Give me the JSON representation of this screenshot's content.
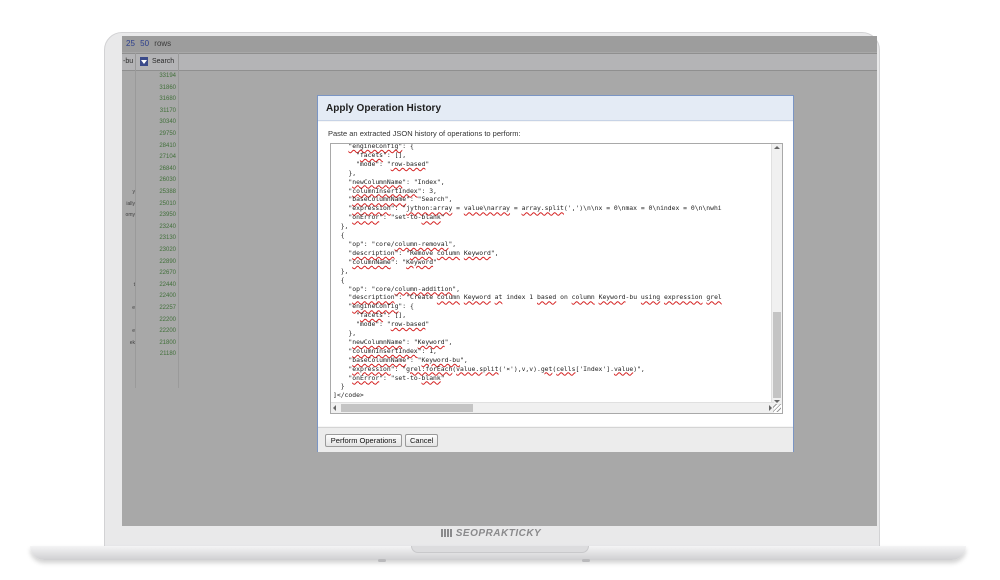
{
  "brand": {
    "name": "SEOPRAKTICKY"
  },
  "background": {
    "rows_control": {
      "option_25": "25",
      "option_50": "50",
      "rows_label": "rows"
    },
    "columns": {
      "left_partial": "-bu",
      "search": "Search"
    },
    "rows": [
      {
        "left": "",
        "value": "33194"
      },
      {
        "left": "",
        "value": "31860"
      },
      {
        "left": "",
        "value": "31680"
      },
      {
        "left": "",
        "value": "31170"
      },
      {
        "left": "",
        "value": "30340"
      },
      {
        "left": "",
        "value": "29750"
      },
      {
        "left": "",
        "value": "28410"
      },
      {
        "left": "",
        "value": "27104"
      },
      {
        "left": "",
        "value": "26840"
      },
      {
        "left": "",
        "value": "26030"
      },
      {
        "left": "y",
        "value": "25388"
      },
      {
        "left": "ially",
        "value": "25010"
      },
      {
        "left": "omy",
        "value": "23950"
      },
      {
        "left": "",
        "value": "23240"
      },
      {
        "left": "",
        "value": "23130"
      },
      {
        "left": "",
        "value": "23020"
      },
      {
        "left": "",
        "value": "22890"
      },
      {
        "left": "",
        "value": "22670"
      },
      {
        "left": "t",
        "value": "22440"
      },
      {
        "left": "",
        "value": "22400"
      },
      {
        "left": "e",
        "value": "22257"
      },
      {
        "left": "",
        "value": "22200"
      },
      {
        "left": "e",
        "value": "22200"
      },
      {
        "left": "ek",
        "value": "21800"
      },
      {
        "left": "",
        "value": "21180"
      }
    ]
  },
  "dialog": {
    "title": "Apply Operation History",
    "instruction": "Paste an extracted JSON history of operations to perform:",
    "buttons": {
      "perform": "Perform Operations",
      "cancel": "Cancel"
    },
    "code_lines": [
      [
        [
          "    ",
          ""
        ],
        [
          "\"engineConfig\"",
          "u"
        ],
        [
          ": {",
          ""
        ]
      ],
      [
        [
          "      \"",
          ""
        ],
        [
          "facets",
          "u"
        ],
        [
          "\": [],",
          ""
        ]
      ],
      [
        [
          "      \"mode\": \"",
          ""
        ],
        [
          "row-based",
          "u"
        ],
        [
          "\"",
          ""
        ]
      ],
      [
        [
          "    },",
          ""
        ]
      ],
      [
        [
          "    \"",
          ""
        ],
        [
          "newColumnName",
          "u"
        ],
        [
          "\": \"Index\",",
          ""
        ]
      ],
      [
        [
          "    \"",
          ""
        ],
        [
          "columnInsertIndex",
          "u"
        ],
        [
          "\": 3,",
          ""
        ]
      ],
      [
        [
          "    \"",
          ""
        ],
        [
          "baseColumnName",
          "u"
        ],
        [
          "\": \"Search\",",
          ""
        ]
      ],
      [
        [
          "    \"",
          ""
        ],
        [
          "expression",
          "u"
        ],
        [
          "\": \"",
          ""
        ],
        [
          "jython:array",
          "u"
        ],
        [
          " = ",
          ""
        ],
        [
          "value\\narray",
          "u"
        ],
        [
          " = ",
          ""
        ],
        [
          "array.split",
          "u"
        ],
        [
          "(',')\\n\\nx = 0\\nmax = 0\\nindex = 0\\n\\nwhi",
          ""
        ]
      ],
      [
        [
          "    \"",
          ""
        ],
        [
          "onError",
          "u"
        ],
        [
          "\": \"set-to-",
          ""
        ],
        [
          "blank",
          "u"
        ],
        [
          "\"",
          ""
        ]
      ],
      [
        [
          "  },",
          ""
        ]
      ],
      [
        [
          "  {",
          ""
        ]
      ],
      [
        [
          "    \"op\": \"core/",
          ""
        ],
        [
          "column-removal",
          "u"
        ],
        [
          "\",",
          ""
        ]
      ],
      [
        [
          "    \"",
          ""
        ],
        [
          "description",
          "u"
        ],
        [
          "\": \"",
          ""
        ],
        [
          "Remove",
          "u"
        ],
        [
          " ",
          ""
        ],
        [
          "column",
          "u"
        ],
        [
          " ",
          ""
        ],
        [
          "Keyword",
          "u"
        ],
        [
          "\",",
          ""
        ]
      ],
      [
        [
          "    \"",
          ""
        ],
        [
          "columnName",
          "u"
        ],
        [
          "\": \"",
          ""
        ],
        [
          "Keyword",
          "u"
        ],
        [
          "\"",
          ""
        ]
      ],
      [
        [
          "  },",
          ""
        ]
      ],
      [
        [
          "  {",
          ""
        ]
      ],
      [
        [
          "    \"op\": \"core/",
          ""
        ],
        [
          "column-addition",
          "u"
        ],
        [
          "\",",
          ""
        ]
      ],
      [
        [
          "    \"",
          ""
        ],
        [
          "description",
          "u"
        ],
        [
          "\": \"Create ",
          ""
        ],
        [
          "column",
          "u"
        ],
        [
          " ",
          ""
        ],
        [
          "Keyword",
          "u"
        ],
        [
          " ",
          ""
        ],
        [
          "at",
          "u"
        ],
        [
          " index 1 ",
          ""
        ],
        [
          "based",
          "u"
        ],
        [
          " on ",
          ""
        ],
        [
          "column",
          "u"
        ],
        [
          " ",
          ""
        ],
        [
          "Keyword",
          "u"
        ],
        [
          "-bu ",
          ""
        ],
        [
          "using",
          "u"
        ],
        [
          " ",
          ""
        ],
        [
          "expression",
          "u"
        ],
        [
          " ",
          ""
        ],
        [
          "grel",
          "u"
        ]
      ],
      [
        [
          "    \"",
          ""
        ],
        [
          "engineConfig",
          "u"
        ],
        [
          "\": {",
          ""
        ]
      ],
      [
        [
          "      \"",
          ""
        ],
        [
          "facets",
          "u"
        ],
        [
          "\": [],",
          ""
        ]
      ],
      [
        [
          "      \"mode\": \"",
          ""
        ],
        [
          "row-based",
          "u"
        ],
        [
          "\"",
          ""
        ]
      ],
      [
        [
          "    },",
          ""
        ]
      ],
      [
        [
          "    \"",
          ""
        ],
        [
          "newColumnName",
          "u"
        ],
        [
          "\": \"",
          ""
        ],
        [
          "Keyword",
          "u"
        ],
        [
          "\",",
          ""
        ]
      ],
      [
        [
          "    \"",
          ""
        ],
        [
          "columnInsertIndex",
          "u"
        ],
        [
          "\": 1,",
          ""
        ]
      ],
      [
        [
          "    \"",
          ""
        ],
        [
          "baseColumnName",
          "u"
        ],
        [
          "\": \"",
          ""
        ],
        [
          "Keyword-bu",
          "u"
        ],
        [
          "\",",
          ""
        ]
      ],
      [
        [
          "    \"",
          ""
        ],
        [
          "expression",
          "u"
        ],
        [
          "\": \"",
          ""
        ],
        [
          "grel:forEach",
          "u"
        ],
        [
          "(",
          ""
        ],
        [
          "value.split",
          "u"
        ],
        [
          "('¤'),v,v).",
          ""
        ],
        [
          "get",
          "u"
        ],
        [
          "(",
          ""
        ],
        [
          "cells",
          "u"
        ],
        [
          "['Index'].",
          ""
        ],
        [
          "value",
          "u"
        ],
        [
          ")\",",
          ""
        ]
      ],
      [
        [
          "    \"",
          ""
        ],
        [
          "onError",
          "u"
        ],
        [
          "\": \"set-to-",
          ""
        ],
        [
          "blank",
          "u"
        ],
        [
          "\"",
          ""
        ]
      ],
      [
        [
          "  }",
          ""
        ]
      ],
      [
        [
          "]</code>",
          ""
        ]
      ]
    ]
  }
}
